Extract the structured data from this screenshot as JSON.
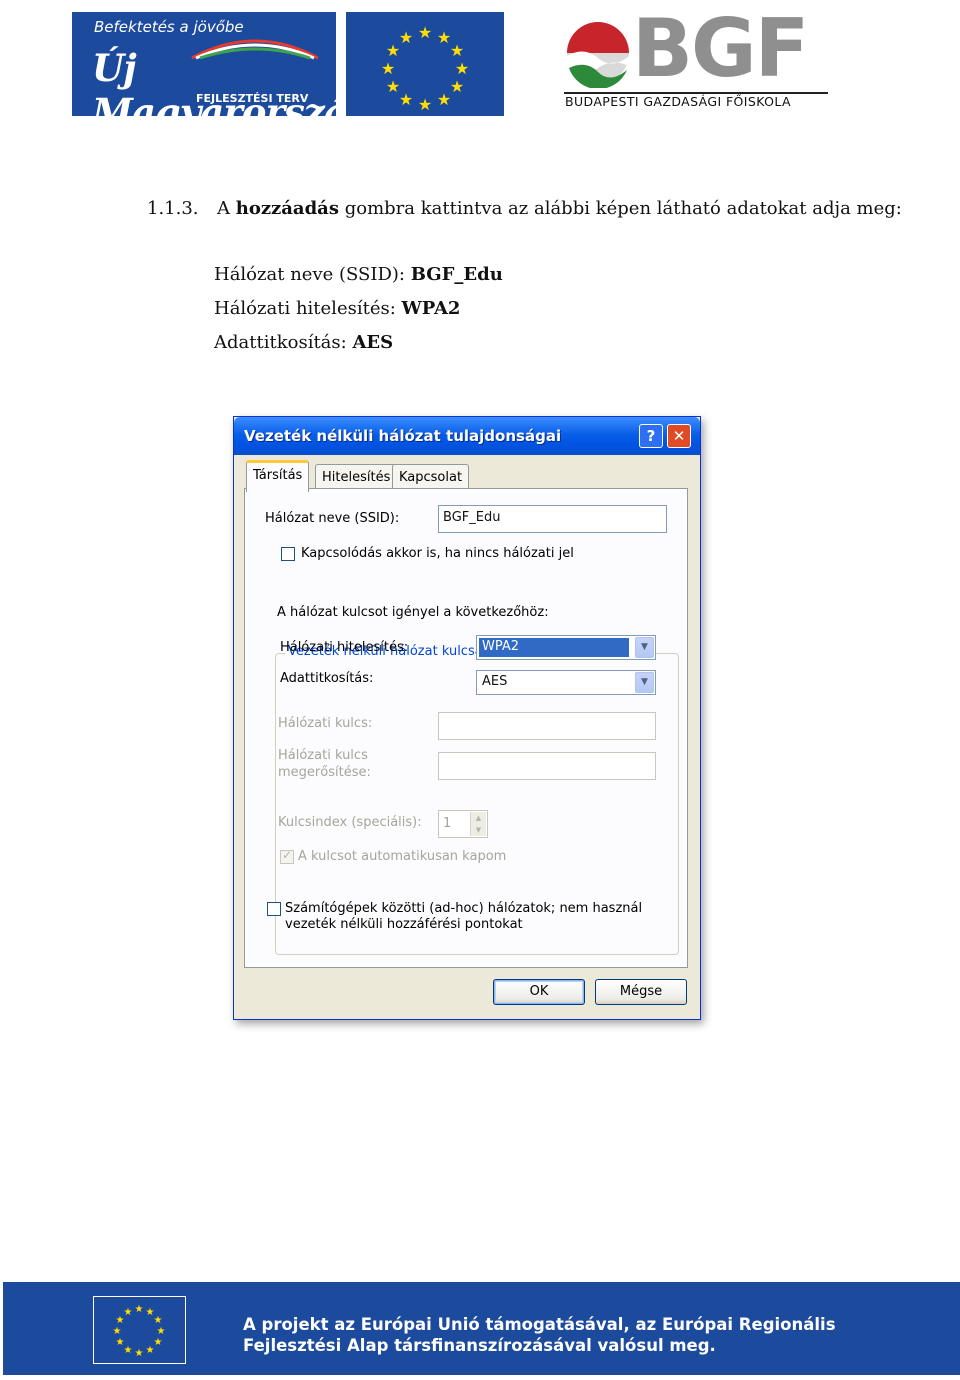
{
  "header": {
    "umft_tagline": "Befektetés a jövőbe",
    "umft_name": "Új Magyarország",
    "umft_sub": "FEJLESZTÉSI TERV",
    "bgf_word": "BGF",
    "bgf_name": "BUDAPESTI GAZDASÁGI FŐISKOLA"
  },
  "step": {
    "number": "1.1.3.",
    "text_before": "A ",
    "bold": "hozzáadás",
    "text_after": " gombra kattintva az alábbi képen látható adatokat adja meg:"
  },
  "settings": [
    {
      "label": "Hálózat neve (SSID): ",
      "value": "BGF_Edu"
    },
    {
      "label": "Hálózati hitelesítés: ",
      "value": "WPA2"
    },
    {
      "label": "Adattitkosítás: ",
      "value": "AES"
    }
  ],
  "dialog": {
    "title": "Vezeték nélküli hálózat tulajdonságai",
    "help_glyph": "?",
    "close_glyph": "✕",
    "tabs": [
      "Társítás",
      "Hitelesítés",
      "Kapcsolat"
    ],
    "ssid_label": "Hálózat neve (SSID):",
    "ssid_value": "BGF_Edu",
    "connect_checkbox_label": "Kapcsolódás akkor is, ha nincs hálózati jel",
    "group_title": "Vezeték nélküli hálózat kulcsa",
    "group_intro": "A hálózat kulcsot igényel a következőhöz:",
    "auth_label": "Hálózati hitelesítés:",
    "auth_value": "WPA2",
    "enc_label": "Adattitkosítás:",
    "enc_value": "AES",
    "key_label": "Hálózati kulcs:",
    "confirm_label_1": "Hálózati kulcs",
    "confirm_label_2": "megerősítése:",
    "keyindex_label": "Kulcsindex (speciális):",
    "keyindex_value": "1",
    "auto_key_label": "A kulcsot automatikusan kapom",
    "adhoc_label_1": "Számítógépek közötti (ad-hoc) hálózatok; nem használ",
    "adhoc_label_2": "vezeték nélküli hozzáférési pontokat",
    "ok_label": "OK",
    "cancel_label": "Mégse"
  },
  "footer": {
    "line1": "A projekt az Európai Unió támogatásával, az Európai Regionális",
    "line2": "Fejlesztési Alap társfinanszírozásával valósul meg."
  }
}
